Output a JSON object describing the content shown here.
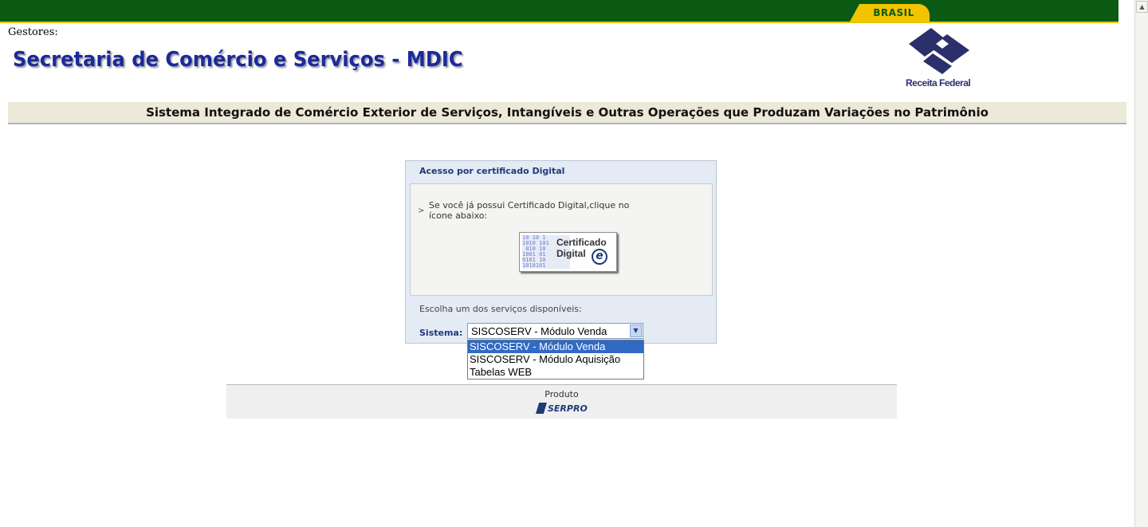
{
  "header": {
    "brasil_label": "BRASIL",
    "gestores_label": "Gestores:",
    "title": "Secretaria de Comércio e Serviços - MDIC",
    "logo_label": "Receita Federal",
    "system_title": "Sistema Integrado de Comércio Exterior de Serviços, Intangíveis e Outras Operações que Produzam Variações no Patrimônio"
  },
  "login": {
    "panel_title": "Acesso por certificado Digital",
    "instruction_arrow": ">",
    "instruction": "Se você já possui Certificado Digital,clique no ícone abaixo:",
    "cert_button_line1": "Certificado",
    "cert_button_line2": "Digital",
    "cert_icon_letter": "e",
    "choose_label": "Escolha um dos serviços disponíveis:",
    "sistema_label": "Sistema:",
    "selected_value": "SISCOSERV - Módulo Venda",
    "options": [
      "SISCOSERV - Módulo Venda",
      "SISCOSERV - Módulo Aquisição",
      "Tabelas WEB"
    ]
  },
  "footer": {
    "produto_label": "Produto",
    "serpro_label": "SERPRO"
  },
  "colors": {
    "topbar": "#0a5a14",
    "brasil_tab": "#f2c400",
    "title_blue": "#1b2a9a",
    "selection": "#316ac5"
  },
  "icons": [
    "receita-federal-logo",
    "certificado-digital-icon",
    "serpro-logo",
    "chevron-down-icon",
    "scroll-up-icon"
  ]
}
